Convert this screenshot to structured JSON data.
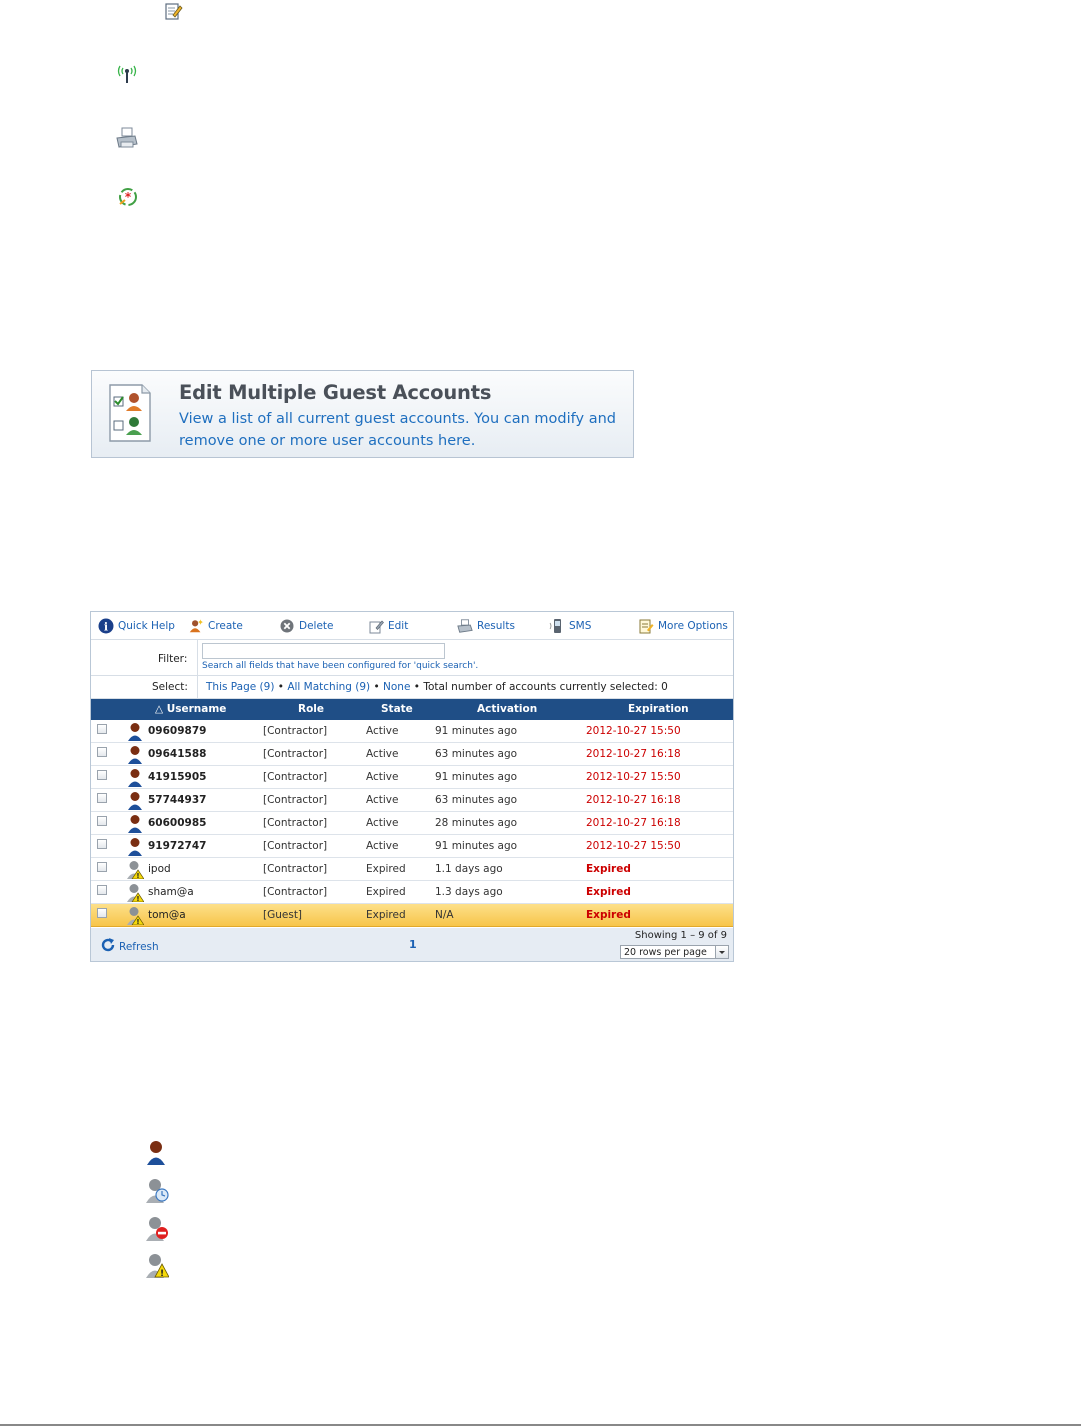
{
  "top_icons": [
    "edit-note-icon",
    "wireless-antenna-icon",
    "printer-icon",
    "sponsor-badge-icon"
  ],
  "banner": {
    "title": "Edit Multiple Guest Accounts",
    "description": "View a list of all current guest accounts. You can modify and remove one or more user accounts here.",
    "icon": "guest-accounts-list-icon"
  },
  "toolbar": {
    "quick_help": "Quick Help",
    "create": "Create",
    "delete": "Delete",
    "edit": "Edit",
    "results": "Results",
    "sms": "SMS",
    "more_options": "More Options"
  },
  "filter": {
    "label": "Filter:",
    "value": "",
    "hint": "Search all fields that have been configured for 'quick search'."
  },
  "select": {
    "label": "Select:",
    "this_page": "This Page (9)",
    "sep1": " • ",
    "all_matching": "All Matching (9)",
    "sep2": " • ",
    "none": "None",
    "sep3": " • ",
    "total": "Total number of accounts currently selected: 0"
  },
  "columns": {
    "username": "△ Username",
    "role": "Role",
    "state": "State",
    "activation": "Activation",
    "expiration": "Expiration"
  },
  "rows": [
    {
      "username": "09609879",
      "role": "[Contractor]",
      "state": "Active",
      "activation": "91 minutes ago",
      "expiration": "2012-10-27 15:50",
      "status": "active"
    },
    {
      "username": "09641588",
      "role": "[Contractor]",
      "state": "Active",
      "activation": "63 minutes ago",
      "expiration": "2012-10-27 16:18",
      "status": "active"
    },
    {
      "username": "41915905",
      "role": "[Contractor]",
      "state": "Active",
      "activation": "91 minutes ago",
      "expiration": "2012-10-27 15:50",
      "status": "active"
    },
    {
      "username": "57744937",
      "role": "[Contractor]",
      "state": "Active",
      "activation": "63 minutes ago",
      "expiration": "2012-10-27 16:18",
      "status": "active"
    },
    {
      "username": "60600985",
      "role": "[Contractor]",
      "state": "Active",
      "activation": "28 minutes ago",
      "expiration": "2012-10-27 16:18",
      "status": "active"
    },
    {
      "username": "91972747",
      "role": "[Contractor]",
      "state": "Active",
      "activation": "91 minutes ago",
      "expiration": "2012-10-27 15:50",
      "status": "active"
    },
    {
      "username": "ipod",
      "role": "[Contractor]",
      "state": "Expired",
      "activation": "1.1 days ago",
      "expiration": "Expired",
      "status": "expired"
    },
    {
      "username": "sham@a",
      "role": "[Contractor]",
      "state": "Expired",
      "activation": "1.3 days ago",
      "expiration": "Expired",
      "status": "expired"
    },
    {
      "username": "tom@a",
      "role": "[Guest]",
      "state": "Expired",
      "activation": "N/A",
      "expiration": "Expired",
      "status": "expired"
    }
  ],
  "footer": {
    "refresh": "Refresh",
    "page": "1",
    "showing": "Showing 1 – 9 of 9",
    "rows_per_page": "20 rows per page"
  },
  "legend_icons": [
    "active-user-icon",
    "pending-user-icon",
    "disabled-user-icon",
    "expired-user-icon"
  ],
  "colors": {
    "header_bg": "#1f4e86",
    "link": "#1b61b3",
    "expiration_red": "#cc0000",
    "selected_row": "#f7c54a"
  }
}
